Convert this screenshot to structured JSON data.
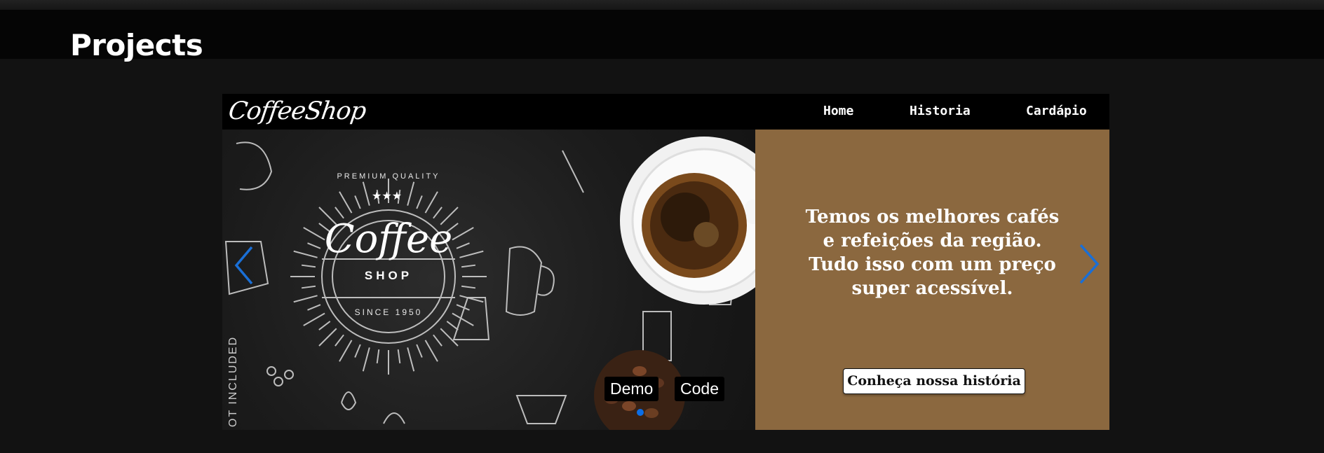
{
  "page": {
    "title": "Projects"
  },
  "project": {
    "brand": "CoffeeShop",
    "nav": [
      {
        "label": "Home"
      },
      {
        "label": "Historia"
      },
      {
        "label": "Cardápio"
      }
    ],
    "hero": {
      "badge_top": "PREMIUM QUALITY",
      "badge_main": "Coffee",
      "badge_sub": "SHOP",
      "badge_since": "SINCE 1950",
      "side_text": "OT INCLUDED",
      "headline": "Temos os melhores cafés e refeições da região. Tudo isso com um preço super acessível.",
      "button_label": "Conheça nossa história",
      "panel_color": "#8b683f"
    },
    "carousel": {
      "demo_label": "Demo",
      "code_label": "Code",
      "prev_icon": "chevron-left-icon",
      "next_icon": "chevron-right-icon",
      "indicator_color": "#0c6ee6"
    }
  }
}
